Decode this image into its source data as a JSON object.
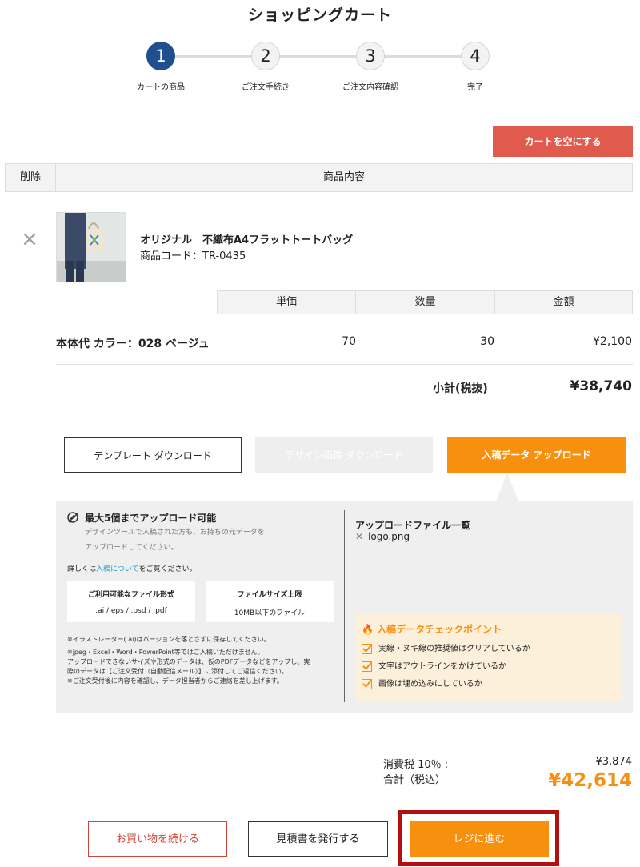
{
  "page": {
    "title": "ショッピングカート"
  },
  "steps": [
    {
      "number": "1",
      "label": "カートの商品"
    },
    {
      "number": "2",
      "label": "ご注文手続き"
    },
    {
      "number": "3",
      "label": "ご注文内容確認"
    },
    {
      "number": "4",
      "label": "完了"
    }
  ],
  "cart": {
    "empty_button": "カートを空にする",
    "header": {
      "delete": "削除",
      "content": "商品内容"
    },
    "remove_icon": "×",
    "product": {
      "name": "オリジナル　不織布A4フラットトートバッグ",
      "code": "商品コード：TR-0435"
    },
    "columns": {
      "unit_price": "単価",
      "quantity": "数量",
      "amount": "金額"
    },
    "row": {
      "label": "本体代 カラー：028 ベージュ",
      "unit_price": "70",
      "quantity": "30",
      "amount": "¥2,100"
    },
    "subtotal_label": "小計(税抜)",
    "subtotal_value": "¥38,740"
  },
  "tabs": {
    "template": "テンプレート ダウンロード",
    "design": "デザイン画像 ダウンロード",
    "upload": "入稿データ アップロード"
  },
  "upload_panel": {
    "title": "最大5個までアップロード可能",
    "note_1": "デザインツールで入稿された方も、お持ちの元データを",
    "note_2": "アップロードしてください。",
    "detail_prefix": "詳しくは",
    "detail_link": "入稿について",
    "detail_suffix": "をご覧ください。",
    "formats_header": "ご利用可能なファイル形式",
    "formats_value": ".ai /.eps / .psd / .pdf",
    "size_header": "ファイルサイズ上限",
    "size_value": "10MB以下のファイル",
    "notes": [
      "※イラストレーター(.ai)はバージョンを落とさずに保存してください。",
      "※jpeg・Excel・Word・PowerPoint等ではご入稿いただけません。",
      "アップロードできないサイズや形式のデータは、仮のPDFデータなどをアップし、実",
      "際のデータは【ご注文受付（自動配信メール）】に添付してご返信ください。",
      "※ご注文受付後に内容を確認し、データ担当者からご連絡を差し上げます。"
    ],
    "files_title": "アップロードファイル一覧",
    "files": [
      {
        "name": "logo.png"
      }
    ],
    "check_title": "入稿データチェックポイント",
    "check_items": [
      "実線・ヌキ線の推奨値はクリアしているか",
      "文字はアウトラインをかけているか",
      "画像は埋め込みにしているか"
    ]
  },
  "totals": {
    "tax_label": "消費税 10％ :",
    "tax_value": "¥3,874",
    "total_label": "合計（税込）",
    "total_value": "¥42,614"
  },
  "actions": {
    "continue": "お買い物を続ける",
    "quote": "見積書を発行する",
    "checkout": "レジに進む"
  },
  "colors": {
    "accent_orange": "#f7900f",
    "danger_red": "#e05a4e",
    "step_active": "#1f4f8e",
    "highlight_frame": "#b30f0f"
  }
}
